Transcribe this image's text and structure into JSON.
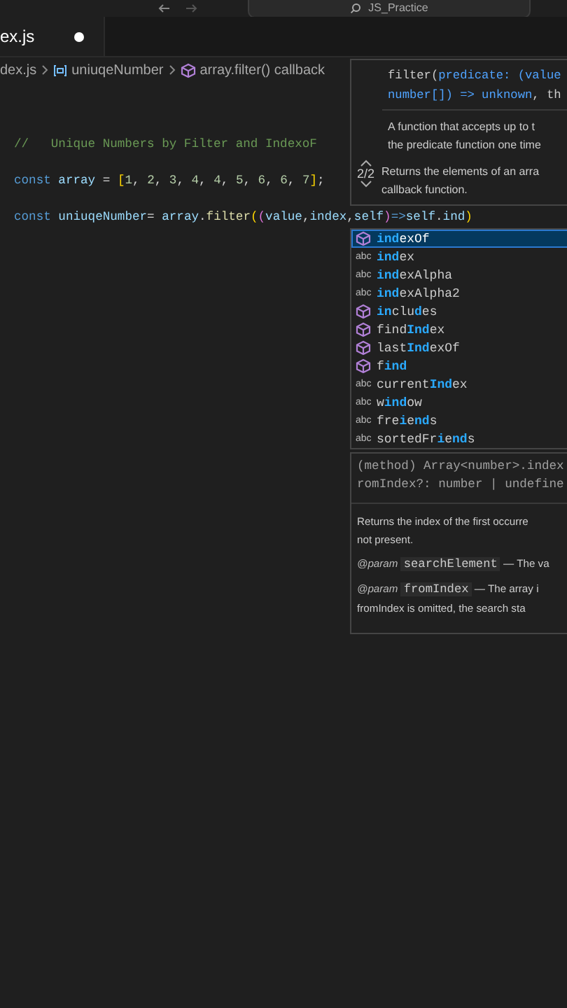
{
  "title_bar": {
    "title": "JS_Practice"
  },
  "tabs": [
    {
      "label": "ex.js",
      "modified": true,
      "selected": true
    }
  ],
  "breadcrumbs": [
    {
      "label": "dex.js",
      "kind": "file"
    },
    {
      "label": "uniuqeNumber",
      "kind": "variable"
    },
    {
      "label": "array.filter() callback",
      "kind": "method"
    }
  ],
  "code_lines": [
    {
      "tokens": [
        {
          "text": "//   Unique Numbers by Filter and IndexoF",
          "kind": "comment"
        }
      ]
    },
    {
      "tokens": [
        {
          "text": "const",
          "kind": "keyword"
        },
        {
          "text": " array",
          "kind": "variable"
        },
        {
          "text": " = ",
          "kind": "punct"
        },
        {
          "text": "[",
          "kind": "bracket"
        },
        {
          "text": "1",
          "kind": "number"
        },
        {
          "text": ", ",
          "kind": "punct"
        },
        {
          "text": "2",
          "kind": "number"
        },
        {
          "text": ", ",
          "kind": "punct"
        },
        {
          "text": "3",
          "kind": "number"
        },
        {
          "text": ", ",
          "kind": "punct"
        },
        {
          "text": "4",
          "kind": "number"
        },
        {
          "text": ", ",
          "kind": "punct"
        },
        {
          "text": "4",
          "kind": "number"
        },
        {
          "text": ", ",
          "kind": "punct"
        },
        {
          "text": "5",
          "kind": "number"
        },
        {
          "text": ", ",
          "kind": "punct"
        },
        {
          "text": "6",
          "kind": "number"
        },
        {
          "text": ", ",
          "kind": "punct"
        },
        {
          "text": "6",
          "kind": "number"
        },
        {
          "text": ", ",
          "kind": "punct"
        },
        {
          "text": "7",
          "kind": "number"
        },
        {
          "text": "]",
          "kind": "bracket"
        },
        {
          "text": ";",
          "kind": "punct"
        }
      ]
    },
    {
      "tokens": [
        {
          "text": "const",
          "kind": "keyword"
        },
        {
          "text": " uniuqeNumber",
          "kind": "variable"
        },
        {
          "text": "= ",
          "kind": "punct"
        },
        {
          "text": "array",
          "kind": "variable"
        },
        {
          "text": ".",
          "kind": "punct"
        },
        {
          "text": "filter",
          "kind": "function"
        },
        {
          "text": "(",
          "kind": "bracket"
        },
        {
          "text": "(",
          "kind": "bracket2"
        },
        {
          "text": "value",
          "kind": "variable"
        },
        {
          "text": ",",
          "kind": "punct"
        },
        {
          "text": "index",
          "kind": "variable"
        },
        {
          "text": ",",
          "kind": "punct"
        },
        {
          "text": "self",
          "kind": "variable"
        },
        {
          "text": ")",
          "kind": "bracket2"
        },
        {
          "text": "=>",
          "kind": "keyword"
        },
        {
          "text": "self",
          "kind": "variable"
        },
        {
          "text": ".",
          "kind": "punct"
        },
        {
          "text": "ind",
          "kind": "variable"
        },
        {
          "text": ")",
          "kind": "bracket"
        }
      ]
    }
  ],
  "signature_help": {
    "counter": "2/2",
    "signature": [
      [
        {
          "text": "filter(",
          "kind": "plain"
        },
        {
          "text": "predicate: (value",
          "kind": "param"
        }
      ],
      [
        {
          "text": "number[]) => unknown",
          "kind": "param"
        },
        {
          "text": ", th",
          "kind": "plain"
        }
      ]
    ],
    "description": [
      "A function that accepts up to t",
      "the predicate function one time"
    ],
    "returns": [
      "Returns the elements of an arra",
      "callback function."
    ]
  },
  "suggestions": [
    {
      "kind": "method",
      "selected": true,
      "parts": [
        {
          "text": "ind",
          "match": true
        },
        {
          "text": "exOf",
          "match": false
        }
      ]
    },
    {
      "kind": "word",
      "icon_text": "abc",
      "selected": false,
      "parts": [
        {
          "text": "ind",
          "match": true
        },
        {
          "text": "ex",
          "match": false
        }
      ]
    },
    {
      "kind": "word",
      "icon_text": "abc",
      "selected": false,
      "parts": [
        {
          "text": "ind",
          "match": true
        },
        {
          "text": "exAlpha",
          "match": false
        }
      ]
    },
    {
      "kind": "word",
      "icon_text": "abc",
      "selected": false,
      "parts": [
        {
          "text": "ind",
          "match": true
        },
        {
          "text": "exAlpha2",
          "match": false
        }
      ]
    },
    {
      "kind": "method",
      "selected": false,
      "parts": [
        {
          "text": "in",
          "match": true
        },
        {
          "text": "clu",
          "match": false
        },
        {
          "text": "d",
          "match": true
        },
        {
          "text": "es",
          "match": false
        }
      ]
    },
    {
      "kind": "method",
      "selected": false,
      "parts": [
        {
          "text": "find",
          "match": false
        },
        {
          "text": "Ind",
          "match": true
        },
        {
          "text": "ex",
          "match": false
        }
      ]
    },
    {
      "kind": "method",
      "selected": false,
      "parts": [
        {
          "text": "last",
          "match": false
        },
        {
          "text": "Ind",
          "match": true
        },
        {
          "text": "exOf",
          "match": false
        }
      ]
    },
    {
      "kind": "method",
      "selected": false,
      "parts": [
        {
          "text": "f",
          "match": false
        },
        {
          "text": "ind",
          "match": true
        }
      ]
    },
    {
      "kind": "word",
      "icon_text": "abc",
      "selected": false,
      "parts": [
        {
          "text": "current",
          "match": false
        },
        {
          "text": "Ind",
          "match": true
        },
        {
          "text": "ex",
          "match": false
        }
      ]
    },
    {
      "kind": "word",
      "icon_text": "abc",
      "selected": false,
      "parts": [
        {
          "text": "w",
          "match": false
        },
        {
          "text": "ind",
          "match": true
        },
        {
          "text": "ow",
          "match": false
        }
      ]
    },
    {
      "kind": "word",
      "icon_text": "abc",
      "selected": false,
      "parts": [
        {
          "text": "fre",
          "match": false
        },
        {
          "text": "i",
          "match": true
        },
        {
          "text": "e",
          "match": false
        },
        {
          "text": "nd",
          "match": true
        },
        {
          "text": "s",
          "match": false
        }
      ]
    },
    {
      "kind": "word",
      "icon_text": "abc",
      "selected": false,
      "parts": [
        {
          "text": "sortedFr",
          "match": false
        },
        {
          "text": "i",
          "match": true
        },
        {
          "text": "e",
          "match": false
        },
        {
          "text": "nd",
          "match": true
        },
        {
          "text": "s",
          "match": false
        }
      ]
    }
  ],
  "suggestion_details": {
    "signature": [
      "(method) Array<number>.index",
      "romIndex?: number | undefine"
    ],
    "description": [
      "Returns the index of the first occurre",
      "not present."
    ],
    "params": [
      {
        "tag": "@param",
        "name": "searchElement",
        "text": "— The va"
      },
      {
        "tag": "@param",
        "name": "fromIndex",
        "text": "— The array i",
        "continuation": "fromIndex is omitted, the search sta"
      }
    ]
  }
}
